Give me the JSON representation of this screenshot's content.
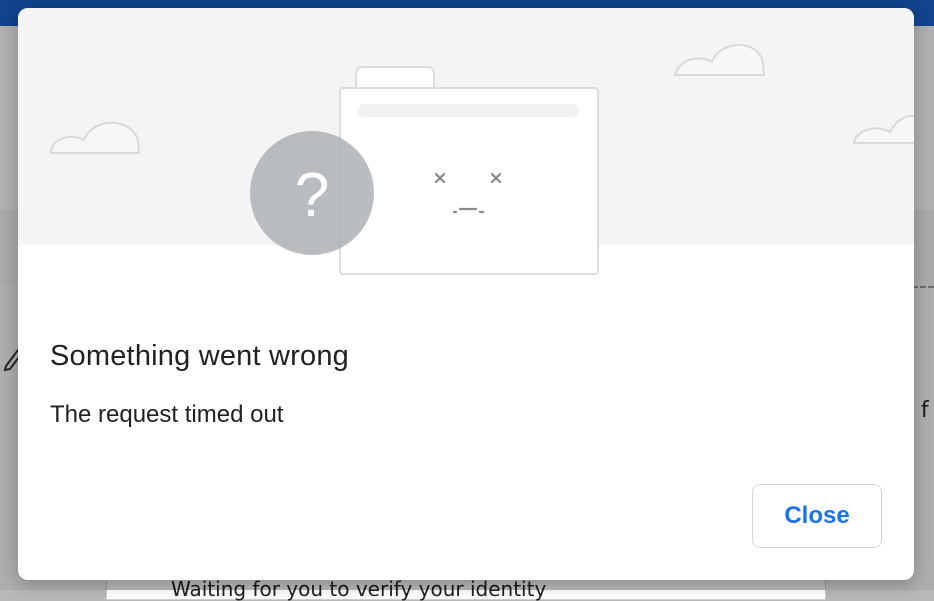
{
  "background": {
    "card_text": "Waiting for you to verify your identity",
    "side_text": "n f"
  },
  "dialog": {
    "illustration": {
      "question_mark": "?"
    },
    "title": "Something went wrong",
    "message": "The request timed out",
    "close_label": "Close"
  },
  "colors": {
    "accent": "#1a73e8",
    "text": "#202124",
    "illustration_band": "#f4f4f4",
    "question_circle": "#b5b8bb"
  }
}
